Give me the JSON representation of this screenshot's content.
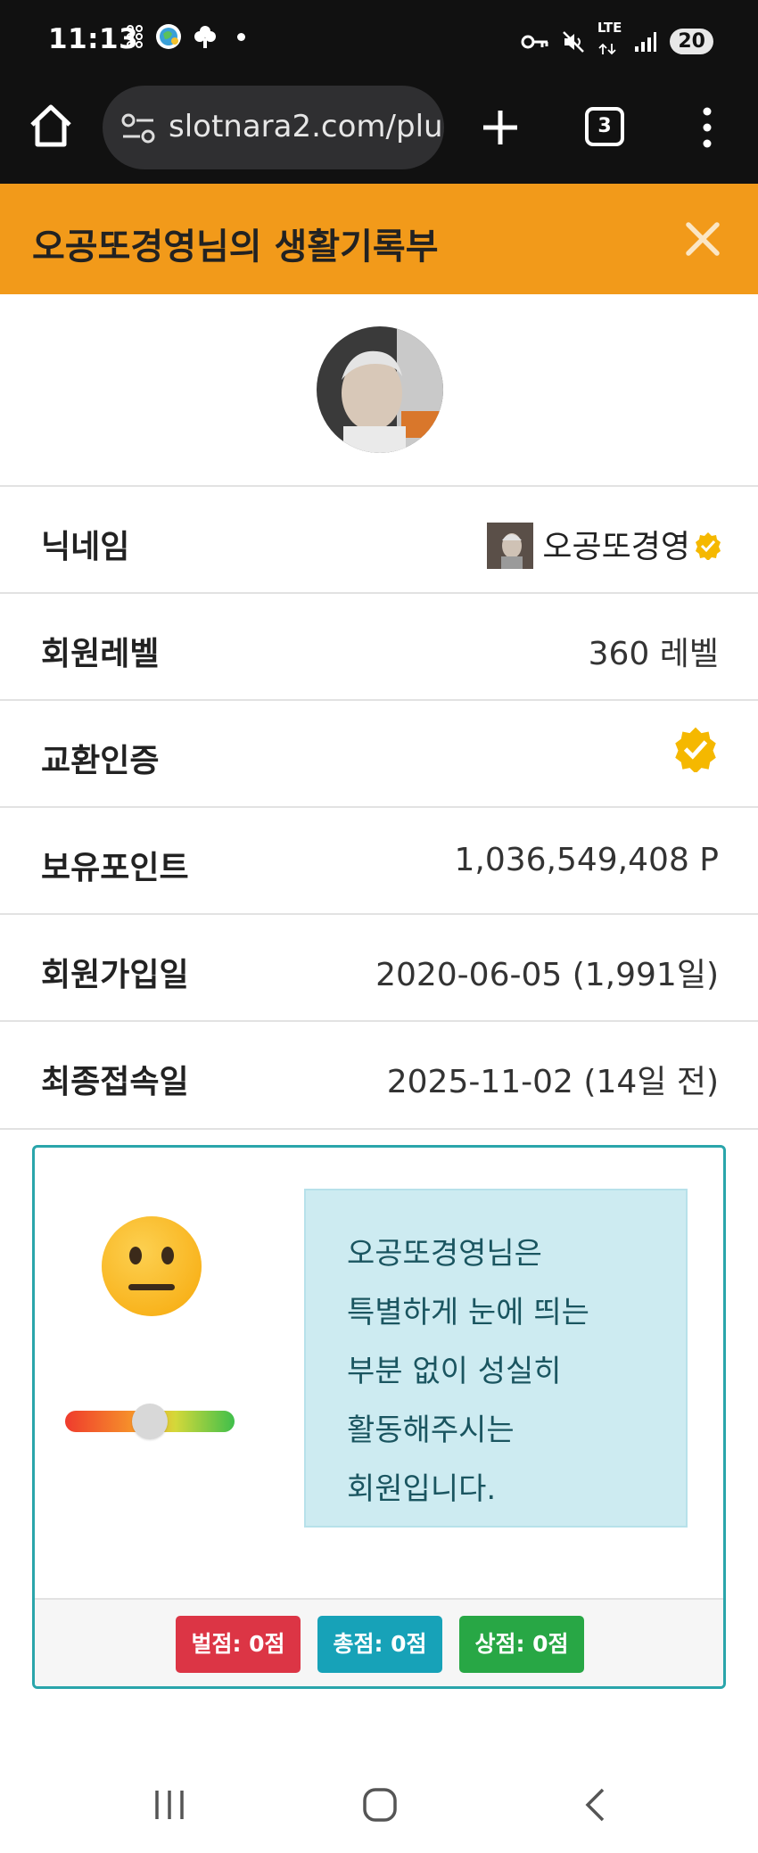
{
  "status_bar": {
    "time": "11:13",
    "lte": "LTE",
    "battery": "20"
  },
  "browser": {
    "url": "slotnara2.com/plu",
    "tab_count": "3"
  },
  "header": {
    "title": "오공또경영님의 생활기록부"
  },
  "profile": {
    "rows": [
      {
        "label": "닉네임",
        "value": "오공또경영"
      },
      {
        "label": "회원레벨",
        "value": "360 레벨"
      },
      {
        "label": "교환인증",
        "value": ""
      },
      {
        "label": "보유포인트",
        "value": "1,036,549,408 P"
      },
      {
        "label": "회원가입일",
        "value": "2020-06-05 (1,991일)"
      },
      {
        "label": "최종접속일",
        "value": "2025-11-02 (14일 전)"
      }
    ]
  },
  "evaluation": {
    "message": "오공또경영님은\n특별하게 눈에 띄는\n부분 없이 성실히\n활동해주시는\n회원입니다.",
    "slider_level": 0.5,
    "scores": {
      "penalty": "벌점: 0점",
      "total": "총점: 0점",
      "reward": "상점: 0점"
    }
  },
  "colors": {
    "header_bg": "#f29a1a",
    "card_border": "#2aa5ab",
    "message_bg": "#cdebf1",
    "penalty": "#dc3545",
    "total": "#17a2b8",
    "reward": "#28a745",
    "badge": "#f5b800"
  },
  "icons": [
    "home-icon",
    "site-settings-icon",
    "new-tab-icon",
    "tab-switcher-icon",
    "menu-icon",
    "close-icon",
    "verified-badge-icon",
    "neutral-face-icon",
    "recent-apps-icon",
    "home-nav-icon",
    "back-icon"
  ]
}
